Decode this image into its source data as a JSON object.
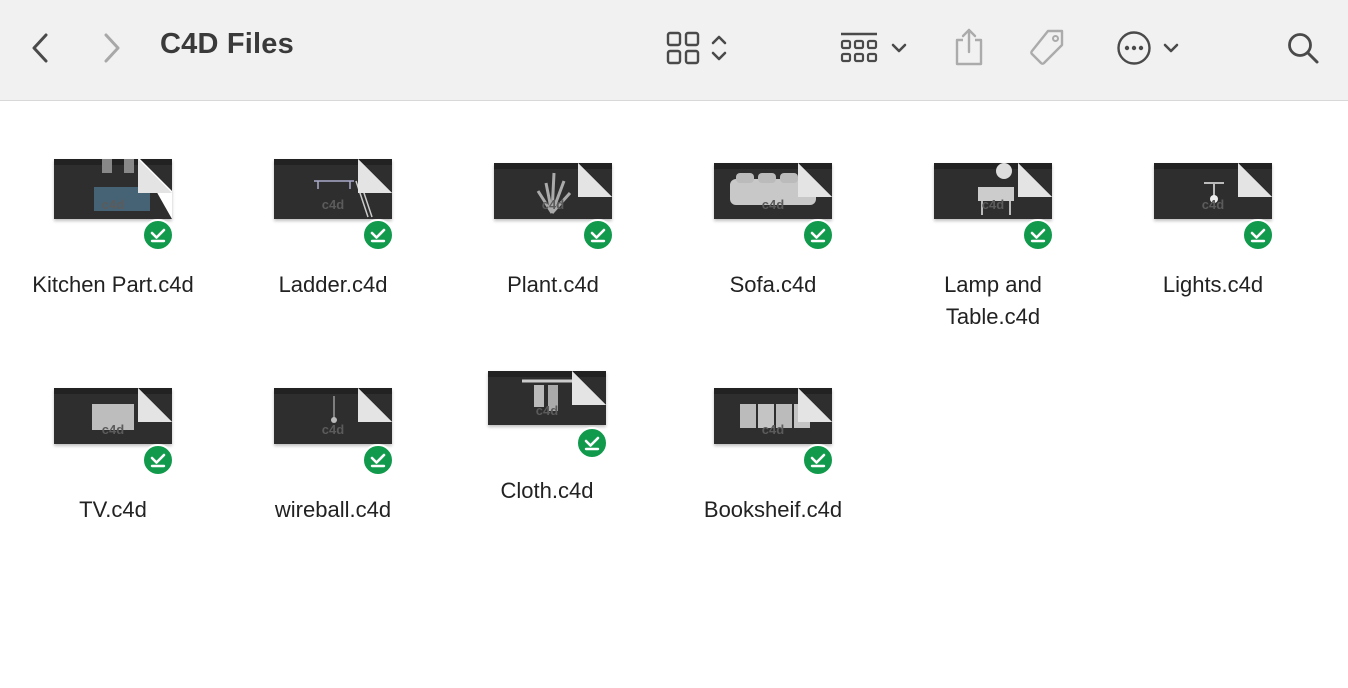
{
  "window": {
    "title": "C4D Files"
  },
  "toolbar": {
    "back": "chevron-left-icon",
    "forward": "chevron-right-icon",
    "view": "grid-view-icon",
    "group": "group-by-icon",
    "share": "share-icon",
    "tag": "tag-icon",
    "more": "more-options-icon",
    "search": "search-icon"
  },
  "files": [
    {
      "name": "Kitchen Part.c4d",
      "badge": "c4d",
      "status": "downloaded"
    },
    {
      "name": "Ladder.c4d",
      "badge": "c4d",
      "status": "downloaded"
    },
    {
      "name": "Plant.c4d",
      "badge": "c4d",
      "status": "downloaded"
    },
    {
      "name": "Sofa.c4d",
      "badge": "c4d",
      "status": "downloaded"
    },
    {
      "name": "Lamp and Table.c4d",
      "badge": "c4d",
      "status": "downloaded"
    },
    {
      "name": "Lights.c4d",
      "badge": "c4d",
      "status": "downloaded"
    },
    {
      "name": "TV.c4d",
      "badge": "c4d",
      "status": "downloaded"
    },
    {
      "name": "wireball.c4d",
      "badge": "c4d",
      "status": "downloaded"
    },
    {
      "name": "Cloth.c4d",
      "badge": "c4d",
      "status": "downloaded"
    },
    {
      "name": "Booksheif.c4d",
      "badge": "c4d",
      "status": "downloaded"
    }
  ],
  "colors": {
    "toolbar_bg": "#f1f1f1",
    "badge_green": "#119a4c",
    "icon_gray": "#4a4a4a"
  }
}
